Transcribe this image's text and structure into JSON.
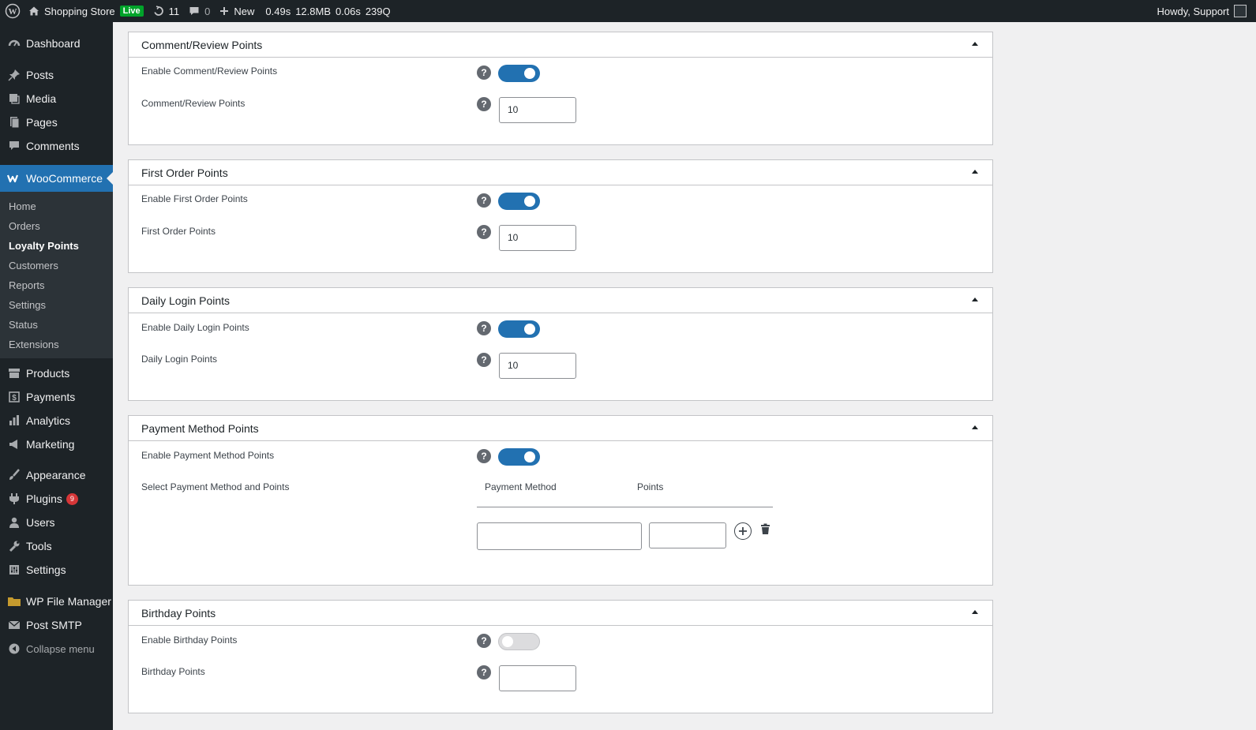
{
  "adminbar": {
    "site_name": "Shopping Store",
    "live_badge": "Live",
    "updates_count": "11",
    "comments_count": "0",
    "new_label": "New",
    "stat_time": "0.49s",
    "stat_memory": "12.8MB",
    "stat_db_time": "0.06s",
    "stat_queries": "239Q",
    "howdy": "Howdy, Support"
  },
  "sidebar": {
    "dashboard": "Dashboard",
    "posts": "Posts",
    "media": "Media",
    "pages": "Pages",
    "comments": "Comments",
    "woocommerce": "WooCommerce",
    "woo_sub": [
      "Home",
      "Orders",
      "Loyalty Points",
      "Customers",
      "Reports",
      "Settings",
      "Status",
      "Extensions"
    ],
    "products": "Products",
    "payments": "Payments",
    "analytics": "Analytics",
    "marketing": "Marketing",
    "appearance": "Appearance",
    "plugins": "Plugins",
    "plugins_badge": "9",
    "users": "Users",
    "tools": "Tools",
    "settings": "Settings",
    "file_manager": "WP File Manager",
    "post_smtp": "Post SMTP",
    "collapse": "Collapse menu"
  },
  "panels": {
    "comment": {
      "title": "Comment/Review Points",
      "enable_label": "Enable Comment/Review Points",
      "enabled": true,
      "points_label": "Comment/Review Points",
      "points_value": "10"
    },
    "first_order": {
      "title": "First Order Points",
      "enable_label": "Enable First Order Points",
      "enabled": true,
      "points_label": "First Order Points",
      "points_value": "10"
    },
    "daily_login": {
      "title": "Daily Login Points",
      "enable_label": "Enable Daily Login Points",
      "enabled": true,
      "points_label": "Daily Login Points",
      "points_value": "10"
    },
    "payment": {
      "title": "Payment Method Points",
      "enable_label": "Enable Payment Method Points",
      "enabled": true,
      "select_label": "Select Payment Method and Points",
      "col_method": "Payment Method",
      "col_points": "Points",
      "method_value": "",
      "points_value": ""
    },
    "birthday": {
      "title": "Birthday Points",
      "enable_label": "Enable Birthday Points",
      "enabled": false,
      "points_label": "Birthday Points",
      "points_value": ""
    }
  },
  "help_glyph": "?",
  "colors": {
    "accent": "#2271b1",
    "sidebar_bg": "#1d2327",
    "live_green": "#00a32a",
    "badge_red": "#d63638"
  }
}
